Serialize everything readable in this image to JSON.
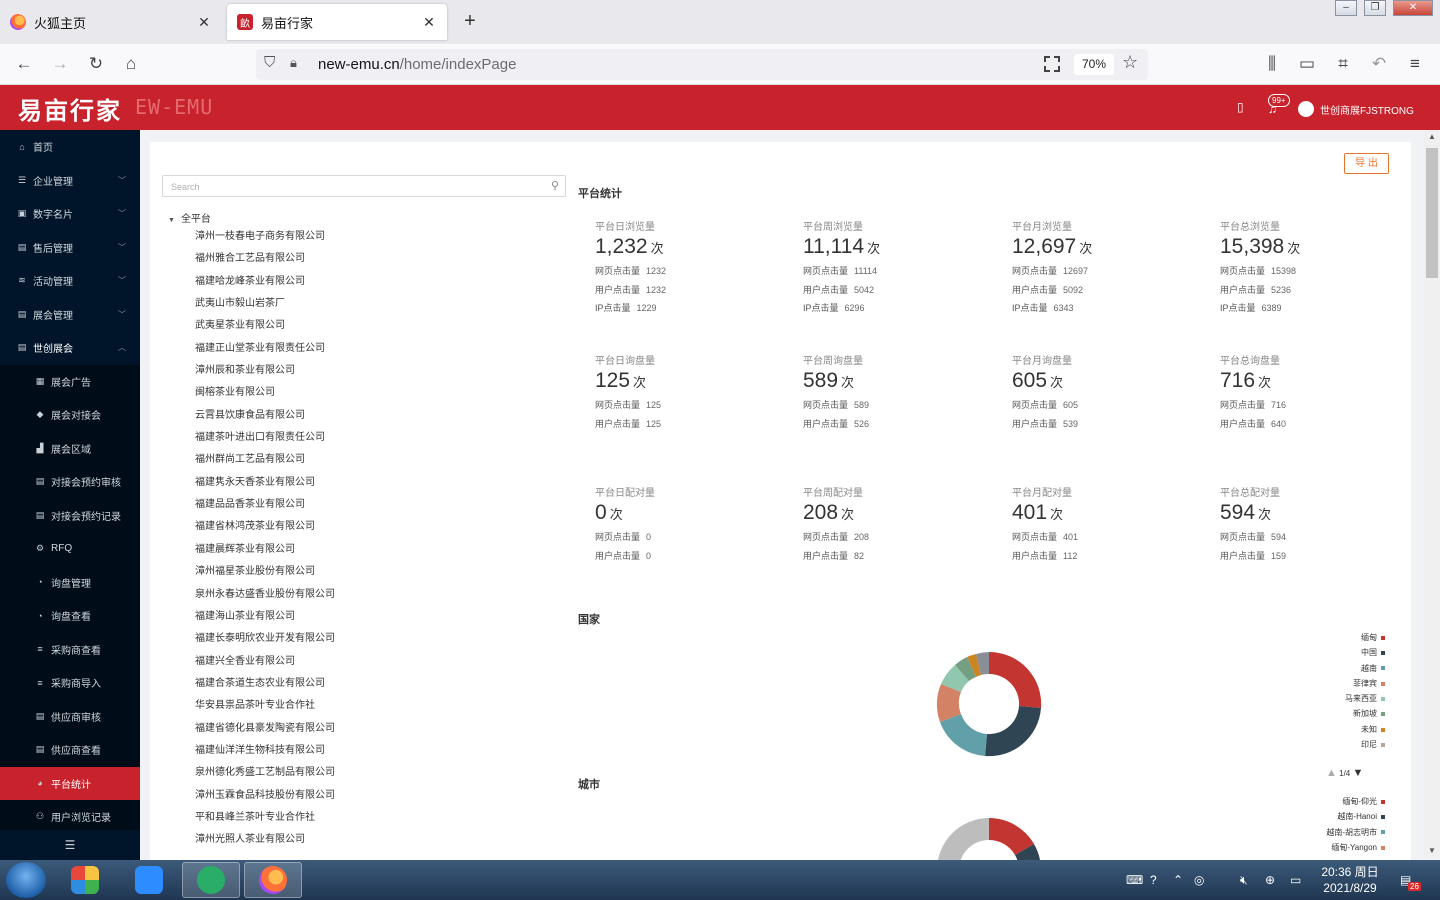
{
  "browser": {
    "tabs": [
      {
        "title": "火狐主页",
        "active": false
      },
      {
        "title": "易亩行家",
        "active": true
      }
    ],
    "url_host": "new-emu.cn",
    "url_path": "/home/indexPage",
    "zoom": "70%"
  },
  "app": {
    "logo": "易亩行家",
    "logo_sub": "EW-EMU",
    "notifications_badge": "99+",
    "user_name": "世创商展FJSTRONG"
  },
  "sidebar": {
    "items": [
      {
        "label": "首页",
        "icon": "home-icon",
        "level": 1
      },
      {
        "label": "企业管理",
        "icon": "server-icon",
        "level": 1,
        "expandable": true
      },
      {
        "label": "数字名片",
        "icon": "id-card-icon",
        "level": 1,
        "expandable": true
      },
      {
        "label": "售后管理",
        "icon": "message-icon",
        "level": 1,
        "expandable": true
      },
      {
        "label": "活动管理",
        "icon": "activity-icon",
        "level": 1,
        "expandable": true
      },
      {
        "label": "展会管理",
        "icon": "list-icon",
        "level": 1,
        "expandable": true
      },
      {
        "label": "世创展会",
        "icon": "list-icon",
        "level": 1,
        "expandable": true,
        "open": true
      },
      {
        "label": "展会广告",
        "icon": "ad-icon",
        "level": 2
      },
      {
        "label": "展会对接会",
        "icon": "tag-icon",
        "level": 2
      },
      {
        "label": "展会区域",
        "icon": "region-icon",
        "level": 2
      },
      {
        "label": "对接会预约审核",
        "icon": "list-icon",
        "level": 2
      },
      {
        "label": "对接会预约记录",
        "icon": "list-icon",
        "level": 2
      },
      {
        "label": "RFQ",
        "icon": "gear-icon",
        "level": 2
      },
      {
        "label": "询盘管理",
        "icon": "question-icon",
        "level": 2
      },
      {
        "label": "询盘查看",
        "icon": "question-icon",
        "level": 2
      },
      {
        "label": "采购商查看",
        "icon": "menu-icon",
        "level": 2
      },
      {
        "label": "采购商导入",
        "icon": "menu-icon",
        "level": 2
      },
      {
        "label": "供应商审核",
        "icon": "list-icon",
        "level": 2
      },
      {
        "label": "供应商查看",
        "icon": "list-icon",
        "level": 2
      },
      {
        "label": "平台统计",
        "icon": "pie-chart-icon",
        "level": 2,
        "active": true
      },
      {
        "label": "用户浏览记录",
        "icon": "users-icon",
        "level": 2
      }
    ]
  },
  "main": {
    "export_label": "导 出",
    "search_placeholder": "Search",
    "tree_root": "全平台",
    "companies": [
      "漳州一枝春电子商务有限公司",
      "福州雅合工艺品有限公司",
      "福建哈龙峰茶业有限公司",
      "武夷山市毅山岩茶厂",
      "武夷星茶业有限公司",
      "福建正山堂茶业有限责任公司",
      "漳州辰和茶业有限公司",
      "闽榕茶业有限公司",
      "云霄县饮康食品有限公司",
      "福建茶叶进出口有限责任公司",
      "福州群尚工艺品有限公司",
      "福建隽永天香茶业有限公司",
      "福建品品香茶业有限公司",
      "福建省林鸿茂茶业有限公司",
      "福建晨辉茶业有限公司",
      "漳州福星茶业股份有限公司",
      "泉州永春达盛香业股份有限公司",
      "福建海山茶业有限公司",
      "福建长泰明欣农业开发有限公司",
      "福建兴全香业有限公司",
      "福建合茶道生态农业有限公司",
      "华安县祟品茶叶专业合作社",
      "福建省德化县豪发陶瓷有限公司",
      "福建仙洋洋生物科技有限公司",
      "泉州德化秀盛工艺制品有限公司",
      "漳州玉霖食品科技股份有限公司",
      "平和县峰兰茶叶专业合作社",
      "漳州光照人茶业有限公司"
    ],
    "stats_title": "平台统计",
    "unit": "次",
    "stat_groups": [
      [
        {
          "label": "平台日浏览量",
          "value": "1,232",
          "rows": [
            {
              "k": "网页点击量",
              "v": "1232"
            },
            {
              "k": "用户点击量",
              "v": "1232"
            },
            {
              "k": "IP点击量",
              "v": "1229"
            }
          ]
        },
        {
          "label": "平台周浏览量",
          "value": "11,114",
          "rows": [
            {
              "k": "网页点击量",
              "v": "11114"
            },
            {
              "k": "用户点击量",
              "v": "5042"
            },
            {
              "k": "IP点击量",
              "v": "6296"
            }
          ]
        },
        {
          "label": "平台月浏览量",
          "value": "12,697",
          "rows": [
            {
              "k": "网页点击量",
              "v": "12697"
            },
            {
              "k": "用户点击量",
              "v": "5092"
            },
            {
              "k": "IP点击量",
              "v": "6343"
            }
          ]
        },
        {
          "label": "平台总浏览量",
          "value": "15,398",
          "rows": [
            {
              "k": "网页点击量",
              "v": "15398"
            },
            {
              "k": "用户点击量",
              "v": "5236"
            },
            {
              "k": "IP点击量",
              "v": "6389"
            }
          ]
        }
      ],
      [
        {
          "label": "平台日询盘量",
          "value": "125",
          "rows": [
            {
              "k": "网页点击量",
              "v": "125"
            },
            {
              "k": "用户点击量",
              "v": "125"
            }
          ]
        },
        {
          "label": "平台周询盘量",
          "value": "589",
          "rows": [
            {
              "k": "网页点击量",
              "v": "589"
            },
            {
              "k": "用户点击量",
              "v": "526"
            }
          ]
        },
        {
          "label": "平台月询盘量",
          "value": "605",
          "rows": [
            {
              "k": "网页点击量",
              "v": "605"
            },
            {
              "k": "用户点击量",
              "v": "539"
            }
          ]
        },
        {
          "label": "平台总询盘量",
          "value": "716",
          "rows": [
            {
              "k": "网页点击量",
              "v": "716"
            },
            {
              "k": "用户点击量",
              "v": "640"
            }
          ]
        }
      ],
      [
        {
          "label": "平台日配对量",
          "value": "0",
          "rows": [
            {
              "k": "网页点击量",
              "v": "0"
            },
            {
              "k": "用户点击量",
              "v": "0"
            }
          ]
        },
        {
          "label": "平台周配对量",
          "value": "208",
          "rows": [
            {
              "k": "网页点击量",
              "v": "208"
            },
            {
              "k": "用户点击量",
              "v": "82"
            }
          ]
        },
        {
          "label": "平台月配对量",
          "value": "401",
          "rows": [
            {
              "k": "网页点击量",
              "v": "401"
            },
            {
              "k": "用户点击量",
              "v": "112"
            }
          ]
        },
        {
          "label": "平台总配对量",
          "value": "594",
          "rows": [
            {
              "k": "网页点击量",
              "v": "594"
            },
            {
              "k": "用户点击量",
              "v": "159"
            }
          ]
        }
      ]
    ],
    "country_title": "国家",
    "country_legend": [
      {
        "name": "缅甸",
        "color": "#c23531"
      },
      {
        "name": "中国",
        "color": "#2f4554"
      },
      {
        "name": "越南",
        "color": "#61a0a8"
      },
      {
        "name": "菲律宾",
        "color": "#d48265"
      },
      {
        "name": "马来西亚",
        "color": "#91c7ae"
      },
      {
        "name": "新加坡",
        "color": "#749f83"
      },
      {
        "name": "未知",
        "color": "#ca8622"
      },
      {
        "name": "印尼",
        "color": "#bda29a"
      }
    ],
    "legend_pager": "1/4",
    "city_title": "城市",
    "city_legend": [
      {
        "name": "缅甸-仰光",
        "color": "#c23531"
      },
      {
        "name": "越南-Hanoi",
        "color": "#2f4554"
      },
      {
        "name": "越南-胡志明市",
        "color": "#61a0a8"
      },
      {
        "name": "缅甸-Yangon",
        "color": "#d48265"
      }
    ]
  },
  "taskbar": {
    "time": "20:36 周日",
    "date": "2021/8/29",
    "notification_count": "26"
  }
}
